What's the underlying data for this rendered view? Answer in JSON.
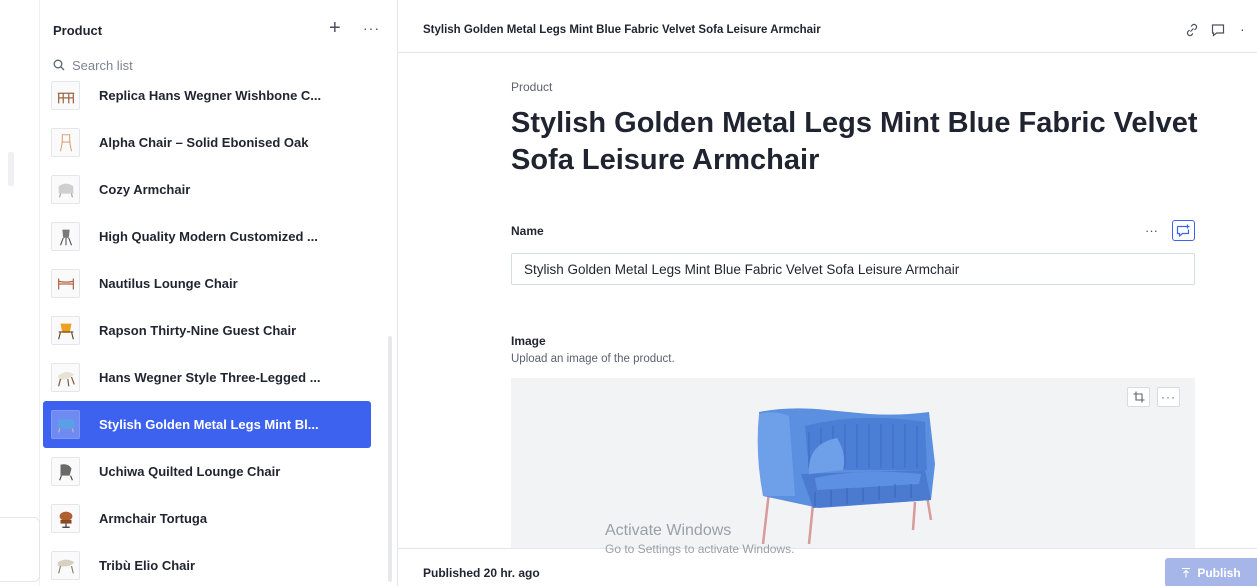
{
  "sidebar_list": {
    "title": "Product",
    "search_placeholder": "Search list",
    "items": [
      {
        "label": "Replica Hans Wegner Wishbone C...",
        "icon": "wishbone-chair-thumb"
      },
      {
        "label": "Alpha Chair – Solid Ebonised Oak",
        "icon": "alpha-chair-thumb"
      },
      {
        "label": "Cozy Armchair",
        "icon": "cozy-armchair-thumb"
      },
      {
        "label": "High Quality Modern Customized ...",
        "icon": "modern-chair-thumb"
      },
      {
        "label": "Nautilus Lounge Chair",
        "icon": "nautilus-chair-thumb"
      },
      {
        "label": "Rapson Thirty-Nine Guest Chair",
        "icon": "rapson-chair-thumb"
      },
      {
        "label": "Hans Wegner Style Three-Legged ...",
        "icon": "three-legged-chair-thumb"
      },
      {
        "label": "Stylish Golden Metal Legs Mint Bl...",
        "icon": "blue-armchair-thumb",
        "selected": true
      },
      {
        "label": "Uchiwa Quilted Lounge Chair",
        "icon": "uchiwa-chair-thumb"
      },
      {
        "label": "Armchair Tortuga",
        "icon": "tortuga-chair-thumb"
      },
      {
        "label": "Tribù Elio Chair",
        "icon": "elio-chair-thumb"
      }
    ]
  },
  "document": {
    "header_title": "Stylish Golden Metal Legs Mint Blue Fabric Velvet Sofa Leisure Armchair",
    "type_label": "Product",
    "title": "Stylish Golden Metal Legs Mint Blue Fabric Velvet Sofa Leisure Armchair",
    "name_field": {
      "label": "Name",
      "value": "Stylish Golden Metal Legs Mint Blue Fabric Velvet Sofa Leisure Armchair"
    },
    "image_field": {
      "label": "Image",
      "description": "Upload an image of the product."
    },
    "footer": {
      "status": "Published 20 hr. ago",
      "publish_label": "Publish"
    }
  },
  "watermark": {
    "line1": "Activate Windows",
    "line2": "Go to Settings to activate Windows."
  },
  "colors": {
    "accent": "#3d62f0",
    "publish_disabled": "#a7b6e8",
    "border": "#e3e6ec"
  }
}
